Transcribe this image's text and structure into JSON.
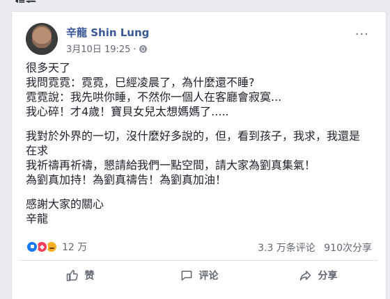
{
  "top_fragment": "信号",
  "post": {
    "author_name": "辛龍 Shin Lung",
    "timestamp": "3月10日 19:25",
    "audience_icon": "globe-icon",
    "menu_icon": "more-icon",
    "menu_text": "···",
    "paragraphs": [
      [
        "很多天了",
        "我問霓霓：霓霓，巳經凌晨了，為什麼還不睡?",
        "霓霓說：我先哄你睡，不然你一個人在客廳會寂寞...",
        "我心碎！才4歲！寶貝女兒太想媽媽了....."
      ],
      [
        "我對於外界的一切，沒什麼好多說的，但，看到孩子，我求，我還是",
        "在求",
        "我祈禱再祈禱，懇請給我們一點空間，請大家為劉真集氣！",
        "為劉真加持！為劉真禱告！為劉真加油！"
      ],
      [
        "感謝大家的關心",
        "辛龍"
      ]
    ]
  },
  "stats": {
    "reaction_icons": [
      "like-icon",
      "love-icon",
      "sad-icon"
    ],
    "reaction_count": "12 万",
    "comments": "3.3 万条评论",
    "shares": "910次分享"
  },
  "actions": {
    "like": "赞",
    "comment": "评论",
    "share": "分享"
  },
  "colors": {
    "page_bg": "#e9ebee",
    "card_bg": "#ffffff",
    "author": "#385898",
    "text": "#1d2129",
    "muted": "#606770",
    "like_blue": "#1877f2",
    "love_red": "#f33e58",
    "sad_yellow": "#f7b125"
  }
}
